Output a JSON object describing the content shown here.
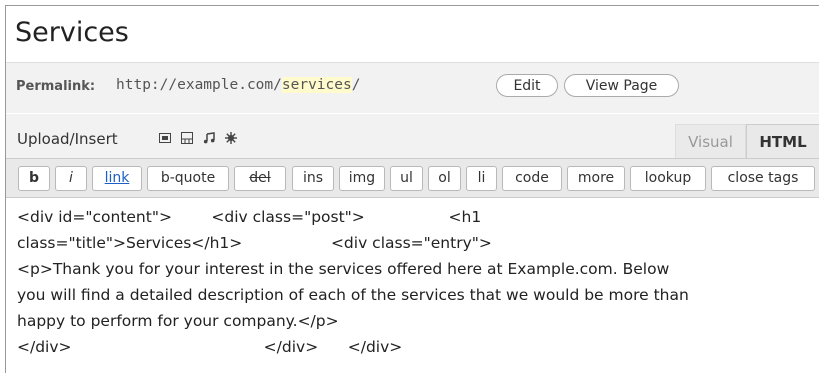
{
  "post": {
    "title": "Services"
  },
  "permalink": {
    "label": "Permalink:",
    "url_prefix": "http://example.com/",
    "slug": "services",
    "url_suffix": "/",
    "edit_label": "Edit",
    "view_label": "View Page"
  },
  "media": {
    "label": "Upload/Insert",
    "icons": [
      "image-icon",
      "video-icon",
      "audio-icon",
      "media-icon"
    ]
  },
  "tabs": {
    "visual": "Visual",
    "html": "HTML",
    "active": "HTML"
  },
  "quicktags": [
    "b",
    "i",
    "link",
    "b-quote",
    "del",
    "ins",
    "img",
    "ul",
    "ol",
    "li",
    "code",
    "more",
    "lookup",
    "close tags"
  ],
  "editor": {
    "lines": [
      "<div id=\"content\">        <div class=\"post\">                 <h1",
      "class=\"title\">Services</h1>                  <div class=\"entry\">",
      "<p>Thank you for your interest in the services offered here at Example.com. Below",
      "you will find a detailed description of each of the services that we would be more than",
      "happy to perform for your company.</p>",
      "</div>                                       </div>      </div>"
    ]
  },
  "colors": {
    "slug_highlight": "#fffbcc",
    "link": "#1e5ec8"
  }
}
